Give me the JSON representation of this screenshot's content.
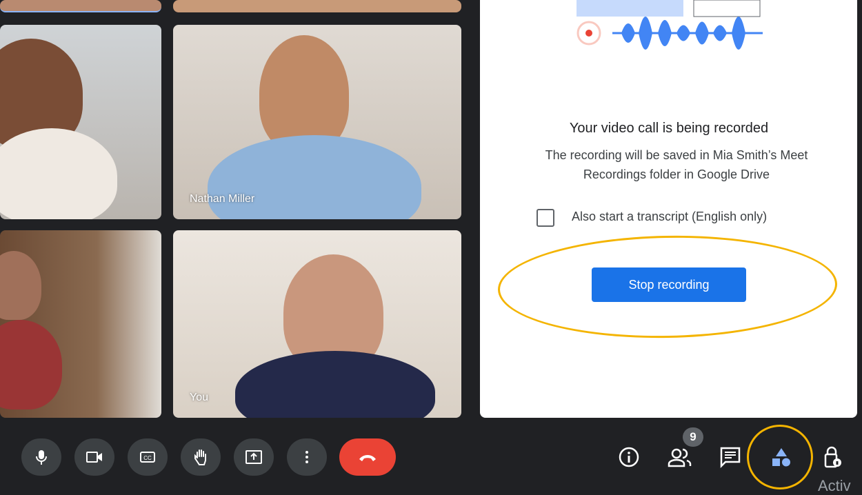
{
  "tiles": [
    {
      "name": ""
    },
    {
      "name": "Nathan Miller"
    },
    {
      "name": ""
    },
    {
      "name": "You"
    }
  ],
  "panel": {
    "title": "Your video call is being recorded",
    "description": "The recording will be saved in Mia Smith’s Meet Recordings folder in Google Drive",
    "transcript_label": "Also start a transcript (English only)",
    "transcript_checked": false,
    "stop_label": "Stop recording"
  },
  "toolbar": {
    "buttons": [
      "mic-icon",
      "camera-icon",
      "captions-icon",
      "raise-hand-icon",
      "present-icon",
      "more-icon",
      "end-call-icon"
    ],
    "people_count": "9",
    "end_call_color": "#ea4335",
    "accent": "#1a73e8",
    "highlight": "#f4b400"
  },
  "watermark": "Activ"
}
